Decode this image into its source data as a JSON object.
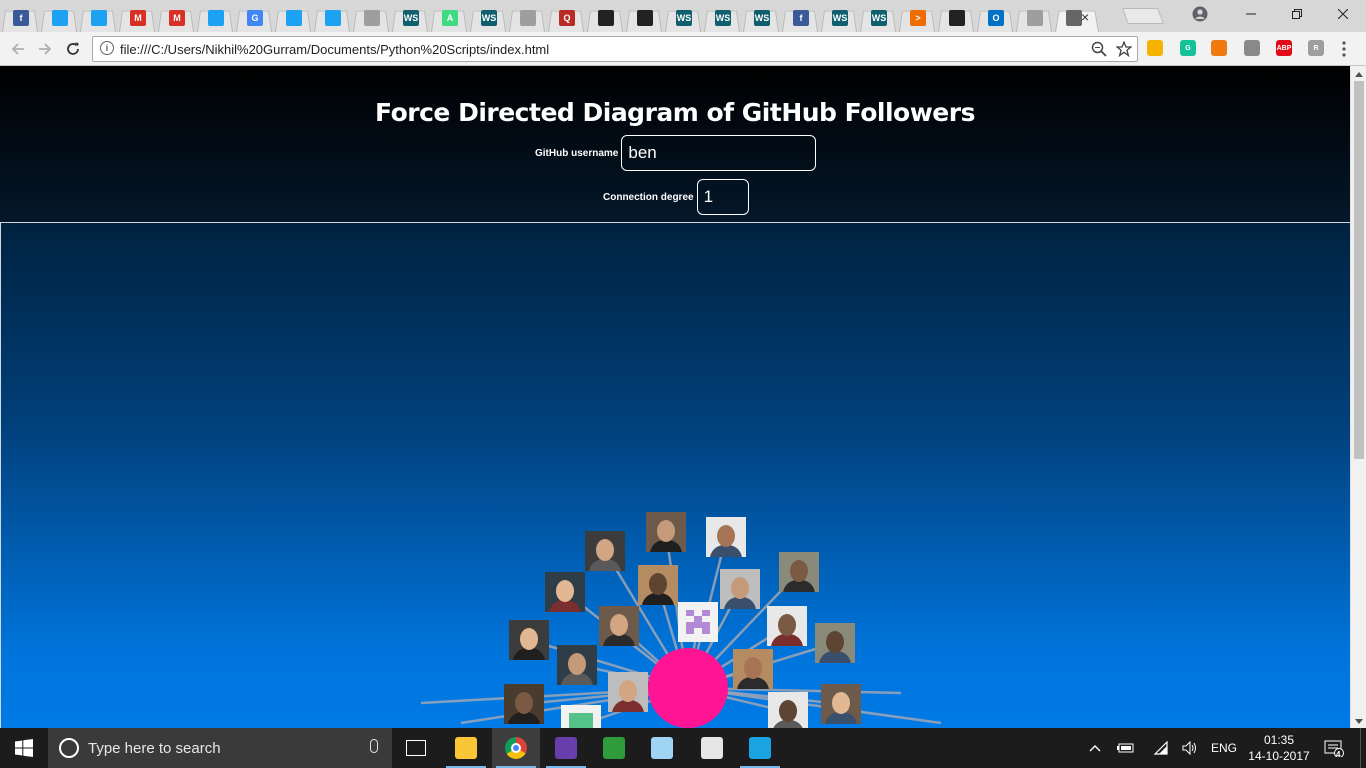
{
  "browser": {
    "tabs": [
      {
        "icon": "facebook-icon",
        "color": "#3b5998",
        "glyph": "f"
      },
      {
        "icon": "twitter-icon",
        "color": "#1da1f2",
        "glyph": ""
      },
      {
        "icon": "twitter-icon",
        "color": "#1da1f2",
        "glyph": ""
      },
      {
        "icon": "gmail-icon",
        "color": "#d93025",
        "glyph": "M"
      },
      {
        "icon": "gmail-icon",
        "color": "#d93025",
        "glyph": "M"
      },
      {
        "icon": "twitter-icon",
        "color": "#1da1f2",
        "glyph": ""
      },
      {
        "icon": "google-icon",
        "color": "#4285f4",
        "glyph": "G"
      },
      {
        "icon": "twitter-icon",
        "color": "#1da1f2",
        "glyph": ""
      },
      {
        "icon": "twitter-icon",
        "color": "#1da1f2",
        "glyph": ""
      },
      {
        "icon": "file-icon",
        "color": "#9e9e9e",
        "glyph": ""
      },
      {
        "icon": "webstorm-icon",
        "color": "#0f5f6e",
        "glyph": "WS"
      },
      {
        "icon": "android-icon",
        "color": "#3ddc84",
        "glyph": "A"
      },
      {
        "icon": "webstorm-icon",
        "color": "#0f5f6e",
        "glyph": "WS"
      },
      {
        "icon": "file-icon",
        "color": "#9e9e9e",
        "glyph": ""
      },
      {
        "icon": "quora-icon",
        "color": "#b92b27",
        "glyph": "Q"
      },
      {
        "icon": "github-icon",
        "color": "#222222",
        "glyph": ""
      },
      {
        "icon": "github-icon",
        "color": "#222222",
        "glyph": ""
      },
      {
        "icon": "webstorm-icon",
        "color": "#0f5f6e",
        "glyph": "WS"
      },
      {
        "icon": "webstorm-icon",
        "color": "#0f5f6e",
        "glyph": "WS"
      },
      {
        "icon": "webstorm-icon",
        "color": "#0f5f6e",
        "glyph": "WS"
      },
      {
        "icon": "facebook-icon",
        "color": "#3b5998",
        "glyph": "f"
      },
      {
        "icon": "webstorm-icon",
        "color": "#0f5f6e",
        "glyph": "WS"
      },
      {
        "icon": "webstorm-icon",
        "color": "#0f5f6e",
        "glyph": "WS"
      },
      {
        "icon": "terminal-icon",
        "color": "#ef6c00",
        "glyph": ">"
      },
      {
        "icon": "github-icon",
        "color": "#222222",
        "glyph": ""
      },
      {
        "icon": "outlook-icon",
        "color": "#0072c6",
        "glyph": "O"
      },
      {
        "icon": "file-icon",
        "color": "#9e9e9e",
        "glyph": ""
      },
      {
        "icon": "loading-icon",
        "color": "#666666",
        "glyph": "",
        "active": true
      }
    ],
    "url": "file:///C:/Users/Nikhil%20Gurram/Documents/Python%20Scripts/index.html",
    "extensions": [
      {
        "icon": "keep-icon",
        "color": "#f6b400",
        "glyph": ""
      },
      {
        "icon": "grammarly-icon",
        "color": "#15c39a",
        "glyph": "G"
      },
      {
        "icon": "honey-icon",
        "color": "#f07a12",
        "glyph": ""
      },
      {
        "icon": "extension-puzzle-icon",
        "color": "#8a8a8a",
        "glyph": ""
      },
      {
        "icon": "adblock-plus-icon",
        "color": "#e20a16",
        "glyph": "ABP"
      },
      {
        "icon": "readability-icon",
        "color": "#9e9e9e",
        "glyph": "R"
      }
    ]
  },
  "page": {
    "title": "Force Directed Diagram of GitHub Followers",
    "username_label": "GitHub username",
    "username_value": "ben",
    "degree_label": "Connection degree",
    "degree_value": "1",
    "graph": {
      "center_node_color": "#ff1493",
      "link_color": "#a0a6b4",
      "follower_count_visible": 23
    }
  },
  "taskbar": {
    "search_placeholder": "Type here to search",
    "apps": [
      {
        "icon": "task-view-icon"
      },
      {
        "icon": "file-explorer-icon",
        "running": true
      },
      {
        "icon": "chrome-icon",
        "running": true,
        "active": true
      },
      {
        "icon": "pdf-reader-icon",
        "running": true
      },
      {
        "icon": "internet-download-manager-icon"
      },
      {
        "icon": "notepad-icon"
      },
      {
        "icon": "7zip-icon"
      },
      {
        "icon": "webstorm-icon",
        "running": true
      }
    ],
    "language": "ENG",
    "time": "01:35",
    "date": "14-10-2017",
    "notification_count": "4"
  }
}
